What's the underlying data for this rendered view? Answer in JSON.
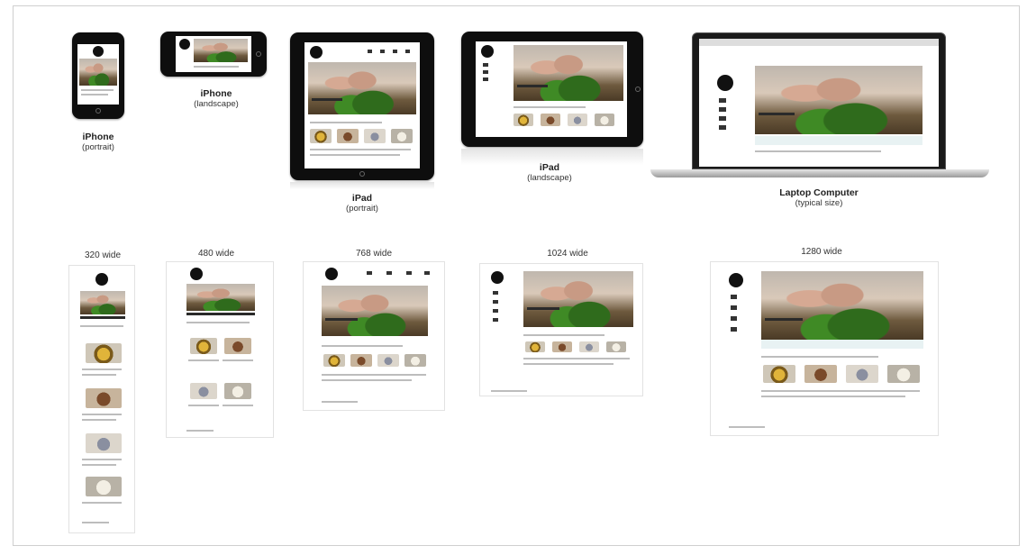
{
  "devices": {
    "iphone_portrait": {
      "title": "iPhone",
      "subtitle": "(portrait)"
    },
    "iphone_landscape": {
      "title": "iPhone",
      "subtitle": "(landscape)"
    },
    "ipad_portrait": {
      "title": "iPad",
      "subtitle": "(portrait)"
    },
    "ipad_landscape": {
      "title": "iPad",
      "subtitle": "(landscape)"
    },
    "laptop": {
      "title": "Laptop Computer",
      "subtitle": "(typical size)"
    }
  },
  "widths": [
    "320 wide",
    "480 wide",
    "768 wide",
    "1024 wide",
    "1280 wide"
  ]
}
